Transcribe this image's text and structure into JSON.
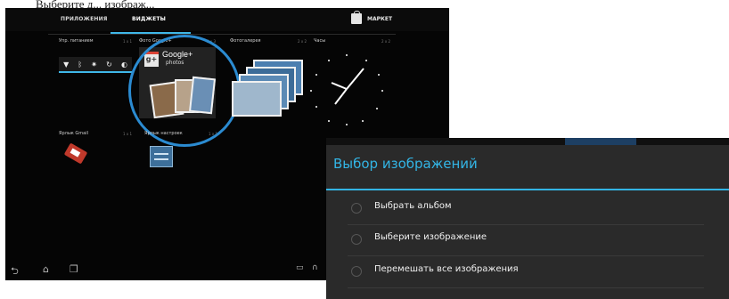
{
  "caption": "Выберите д... изображ...",
  "tabs": [
    "ПРИЛОЖЕНИЯ",
    "ВИДЖЕТЫ"
  ],
  "market_label": "МАРКЕТ",
  "widgets": {
    "power": {
      "label": "Упр. питанием",
      "size": "1 x 1"
    },
    "gplus": {
      "label": "Фото Google+",
      "size": "3 x 3",
      "brand": "Google+",
      "sub": "photos"
    },
    "gallery": {
      "label": "Фотогалерея",
      "size": "2 x 2"
    },
    "clock": {
      "label": "Часы",
      "size": "2 x 2"
    },
    "gmail": {
      "label": "Ярлык Gmail",
      "size": "1 x 1"
    },
    "settings": {
      "label": "Ярлык настроек",
      "size": "1 x 1"
    }
  },
  "dialog": {
    "title": "Выбор изображений",
    "options": [
      "Выбрать альбом",
      "Выберите изображение",
      "Перемешать все изображения"
    ]
  },
  "colors": {
    "accent": "#33b5e5",
    "highlight_circle": "#2b8bd1"
  }
}
